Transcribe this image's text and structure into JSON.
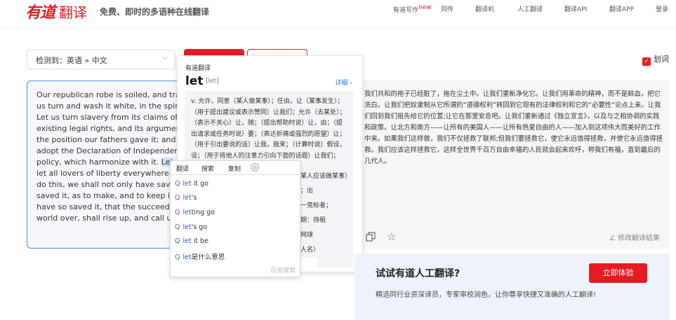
{
  "header": {
    "logo_main": "有道",
    "logo_sub": "翻译",
    "tagline": "免费、即时的多语种在线翻译",
    "nav": [
      {
        "label": "有道写作",
        "badge": "new"
      },
      {
        "label": "同传"
      },
      {
        "label": "翻译机"
      },
      {
        "label": "人工翻译"
      },
      {
        "label": "翻译API"
      },
      {
        "label": "翻译APP"
      },
      {
        "label": "登录"
      }
    ]
  },
  "toolbar": {
    "detect_label": "检测到：英语 » 中文",
    "chevron": "chevron-down-icon",
    "dict_toggle_label": "划词"
  },
  "source": {
    "lines": [
      "Our republican robe is soiled, and tra",
      "us turn and wash it white, in the spirit",
      "Let us turn slavery from its claims of",
      "existing legal rights, and its argument",
      "the position our fathers gave it; and t",
      "adopt the Declaration of Independen",
      "policy, which harmonize with it.",
      "let all lovers of liberty everywhere—",
      "do this, we shall not only have saved",
      "saved it, as to make, and to keep it,",
      "have so saved it, that the succeedin",
      "world over, shall rise up, and call us"
    ],
    "highlight": "Let",
    "highlight_tail": " n"
  },
  "dict": {
    "source_label": "有道翻译",
    "word": "let",
    "phonetic": "[let]",
    "more_label": "详细 ›",
    "definition": "v. 允许，同意（某人做某事）；任由，让（某事发生）；（用于提出建议或表示赞同）让我们；允许（去某处）；（表示不关心）让，随；（提出帮助时说）让，由；（提出请求或任务时说）要；（表达祈祷或强烈的愿望）让；（用于引出要说的话）让我，我来；（计算时说）假设，设；（用于将他人的注意力引向下面的话题）让我们；（表示抗拒或忍",
    "behind_lines": [
      "为某人应该做某事）让；出",
      "某一竞标者；",
      "租期：待租",
      "擦网球",
      "（人名）"
    ]
  },
  "autocomplete": {
    "tabs": [
      "翻译",
      "搜索",
      "复制"
    ],
    "circle_icon": "target-icon",
    "suggestions": [
      {
        "bold": "let",
        "rest": " it go"
      },
      {
        "bold": "let",
        "rest": "'s"
      },
      {
        "bold": "let",
        "rest": "ting go"
      },
      {
        "bold": "let",
        "rest": "'s go"
      },
      {
        "bold": "let",
        "rest": " it be"
      },
      {
        "bold": "let",
        "rest": "是什么意思"
      }
    ],
    "provider": "百度搜索"
  },
  "target": {
    "text": "我们共和的袍子已经脏了，拖在尘土中。让我们重新净化它。让我们用革命的精神，而不是鲜血，把它洗白。让我们把奴隶制从它所谓的“道德权利”转回到它现有的法律权利和它的“必要性”论点上来。让我们回到我们祖先给它的位置;让它在那里安息吧。让我们重新通过《独立宣言》，以及与之相协调的实践和政策。让北方和南方——让所有的美国人——让所有热爱自由的人——加入到这项伟大而美好的工作中来。如果我们这样做，我们不仅拯救了联邦;但我们要拯救它，使它永远值得拯救，并使它永远值得拯救。我们应该这样拯救它，这样全世界千百万自由幸福的人民就会起来欢呼，称我们有福，直到最后的几代人。",
    "edit_label": "修改翻译结果"
  },
  "ad": {
    "title": "试试有道人工翻译?",
    "desc": "精选同行业资深译员，专家审校润色，让你尊享快捷又准确的人工翻译!",
    "button": "立即体验"
  }
}
